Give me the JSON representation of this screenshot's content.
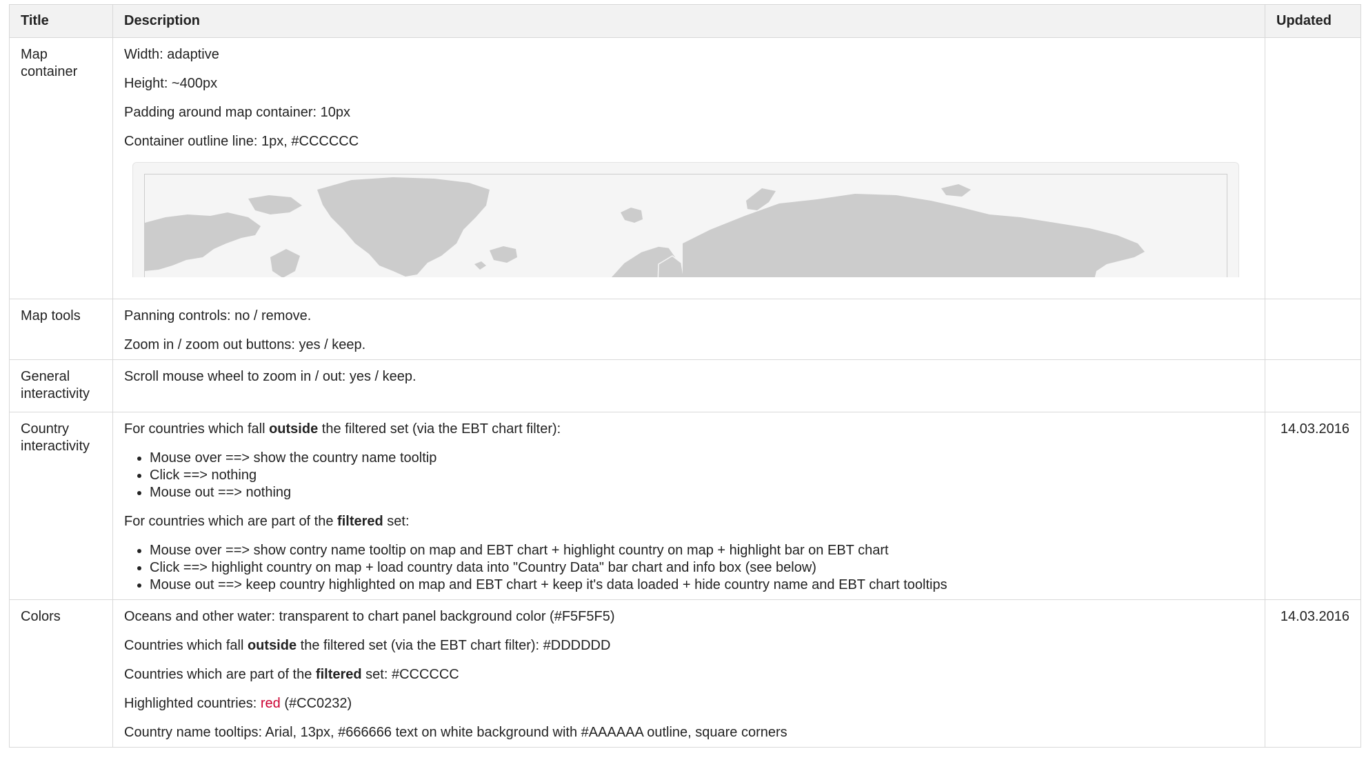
{
  "table": {
    "headers": {
      "title": "Title",
      "description": "Description",
      "updated": "Updated"
    },
    "rows": [
      {
        "title": "Map container",
        "paragraphs": [
          "Width: adaptive",
          "Height: ~400px",
          "Padding around map container: 10px",
          "Container outline line: 1px, #CCCCCC"
        ],
        "updated": ""
      },
      {
        "title": "Map tools",
        "paragraphs": [
          "Panning controls: no / remove.",
          "Zoom in / zoom out buttons: yes / keep."
        ],
        "updated": ""
      },
      {
        "title": "General interactivity",
        "paragraphs": [
          "Scroll mouse wheel to zoom in / out: yes / keep."
        ],
        "updated": ""
      },
      {
        "title": "Country interactivity",
        "outside_intro": {
          "pre": "For countries which fall ",
          "bold": "outside",
          "post": " the filtered set (via the EBT chart filter):"
        },
        "outside_items": [
          "Mouse over ==> show the country name tooltip",
          "Click ==> nothing",
          "Mouse out ==> nothing"
        ],
        "filtered_intro": {
          "pre": "For countries which are part of the ",
          "bold": "filtered",
          "post": " set:"
        },
        "filtered_items": [
          "Mouse over ==> show contry name tooltip on map and EBT chart + highlight country on map + highlight bar on EBT chart",
          "Click ==> highlight country on map + load country data into \"Country Data\" bar chart and info box (see below)",
          "Mouse out ==> keep country highlighted on map and EBT chart + keep it's data loaded + hide country name and EBT chart tooltips"
        ],
        "updated": "14.03.2016"
      },
      {
        "title": "Colors",
        "oceans": "Oceans and other water: transparent to chart panel background color (#F5F5F5)",
        "outside": {
          "pre": "Countries which fall ",
          "bold": "outside",
          "post": " the filtered set (via the EBT chart filter): #DDDDDD"
        },
        "filtered": {
          "pre": "Countries which are part of the ",
          "bold": "filtered",
          "post": " set: #CCCCCC"
        },
        "highlighted": {
          "pre": "Highlighted countries: ",
          "red": "red",
          "post": " (#CC0232)"
        },
        "tooltips": "Country name tooltips: Arial, 13px, #666666 text on white background with #AAAAAA outline, square corners",
        "updated": "14.03.2016"
      }
    ]
  },
  "colors": {
    "filtered_country": "#CCCCCC",
    "outside_country": "#DDDDDD",
    "highlight": "#CC0232",
    "panel_background": "#F5F5F5",
    "outline": "#CCCCCC"
  }
}
